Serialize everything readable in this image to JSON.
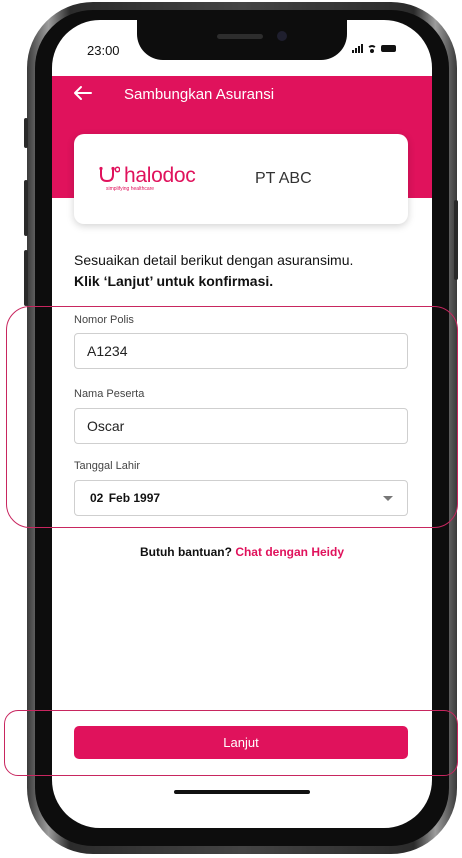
{
  "status_bar": {
    "time": "23:00"
  },
  "header": {
    "title": "Sambungkan Asuransi"
  },
  "insurer_card": {
    "logo_text": "halodoc",
    "logo_tagline": "simplifying healthcare",
    "company_name": "PT ABC"
  },
  "instruction": {
    "line1": "Sesuaikan detail berikut dengan asuransimu.",
    "line2": "Klik ‘Lanjut’ untuk konfirmasi."
  },
  "form": {
    "policy_number": {
      "label": "Nomor Polis",
      "value": "A1234"
    },
    "participant_name": {
      "label": "Nama Peserta",
      "value": "Oscar"
    },
    "birth_date": {
      "label": "Tanggal Lahir",
      "day": "02",
      "month_year": "Feb 1997"
    }
  },
  "help": {
    "prefix": "Butuh bantuan?",
    "link": "Chat dengan Heidy"
  },
  "submit": {
    "label": "Lanjut"
  },
  "colors": {
    "brand": "#e0125c",
    "highlight": "#c8265f"
  },
  "icons": [
    "arrow-left-icon",
    "stethoscope-icon",
    "chevron-down-icon",
    "signal-icon",
    "wifi-icon",
    "battery-icon"
  ]
}
